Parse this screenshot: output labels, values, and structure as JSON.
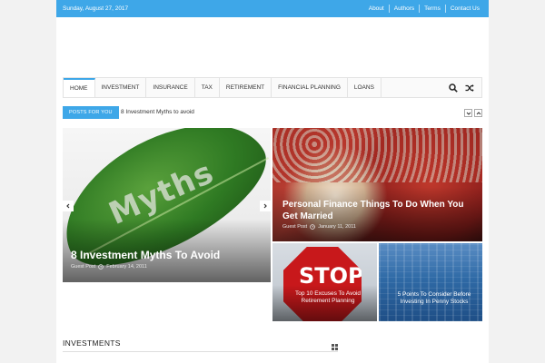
{
  "topbar": {
    "date": "Sunday, August 27, 2017",
    "links": [
      "About",
      "Authors",
      "Terms",
      "Contact Us"
    ]
  },
  "nav": {
    "items": [
      "HOME",
      "INVESTMENT",
      "INSURANCE",
      "TAX",
      "RETIREMENT",
      "FINANCIAL PLANNING",
      "LOANS"
    ],
    "active": "HOME",
    "tool_icons": [
      "search-icon",
      "shuffle-icon"
    ]
  },
  "ticker": {
    "badge": "POSTS FOR YOU",
    "headline": "8 Investment Myths to avoid"
  },
  "slider": {
    "image_text": "Myths",
    "title": "8 Investment Myths To Avoid",
    "author": "Guest Post",
    "date": "February 14, 2011"
  },
  "features": {
    "wedding": {
      "title": "Personal Finance Things To Do When You Get Married",
      "author": "Guest Post",
      "date": "January 11, 2011"
    },
    "stop": {
      "sign_text": "STOP",
      "title": "Top 10 Excuses To Avoid Retirement Planning"
    },
    "stocks": {
      "title": "5 Points To Consider Before Investing In Penny Stocks"
    }
  },
  "section": {
    "heading": "INVESTMENTS"
  },
  "colors": {
    "accent": "#3ea7e8"
  }
}
